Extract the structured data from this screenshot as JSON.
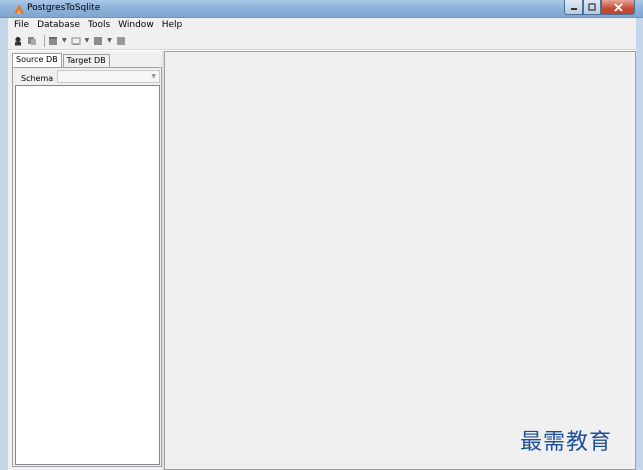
{
  "window": {
    "title": "PostgresToSqlite"
  },
  "menu": {
    "items": [
      "File",
      "Database",
      "Tools",
      "Window",
      "Help"
    ]
  },
  "toolbar": {
    "icons": [
      "connect-icon",
      "disconnect-icon",
      "table-icon",
      "query-icon",
      "grid-icon",
      "export-icon"
    ]
  },
  "left_panel": {
    "tabs": [
      "Source DB",
      "Target DB"
    ],
    "active_tab": "Source DB",
    "schema_label": "Schema",
    "schema_value": ""
  },
  "watermark": {
    "text": "最需教育"
  },
  "colors": {
    "titlebar": "#8fb4da",
    "close_button": "#c74b36",
    "watermark": "#1b4f9c",
    "background": "#f0f0f0"
  }
}
